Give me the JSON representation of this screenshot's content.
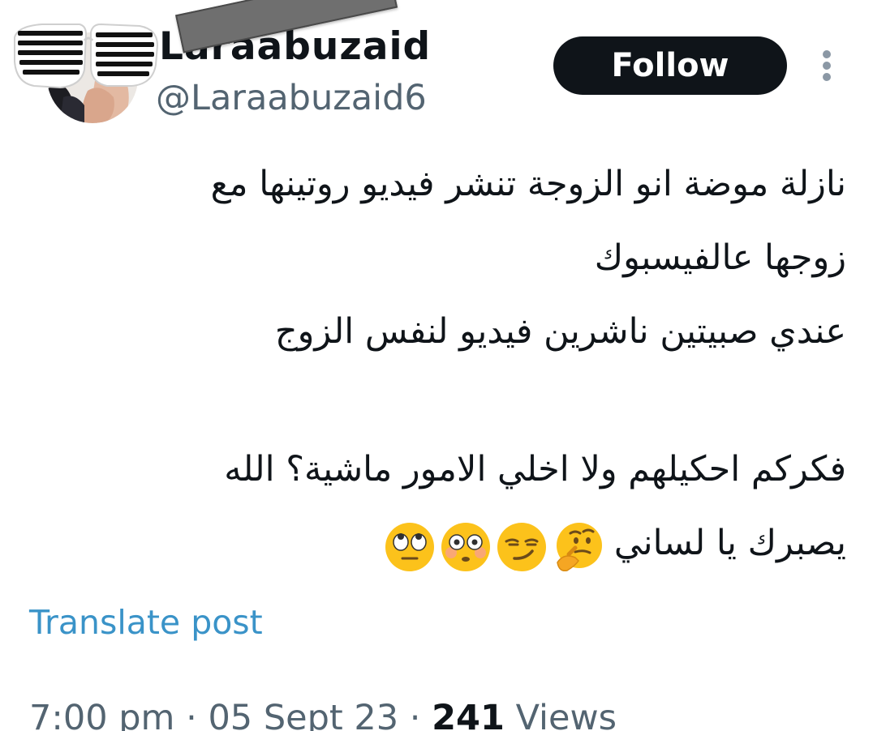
{
  "user": {
    "display_name": "Laraabuzaid",
    "handle": "@Laraabuzaid6"
  },
  "actions": {
    "follow_label": "Follow",
    "more_icon": "more-vertical-icon"
  },
  "tweet": {
    "lines": [
      "نازلة موضة انو الزوجة تنشر فيديو روتينها مع",
      "زوجها عالفيسبوك",
      "عندي صبيتين ناشرين فيديو لنفس الزوج",
      "",
      "فكركم احكيلهم ولا اخلي الامور ماشية؟ الله",
      "يصبرك يا لساني"
    ],
    "emojis": [
      "thinking-face",
      "smirking-face",
      "flushed-face",
      "face-with-rolling-eyes"
    ]
  },
  "translate_label": "Translate post",
  "meta": {
    "time": "7:00 pm",
    "separator": " · ",
    "date": "05 Sept 23",
    "views_count": "241",
    "views_label": "Views"
  },
  "colors": {
    "text": "#0f1419",
    "secondary": "#536471",
    "link": "#3a93c8",
    "follow_bg": "#0f1419",
    "emoji_yellow": "#fcc21b"
  }
}
